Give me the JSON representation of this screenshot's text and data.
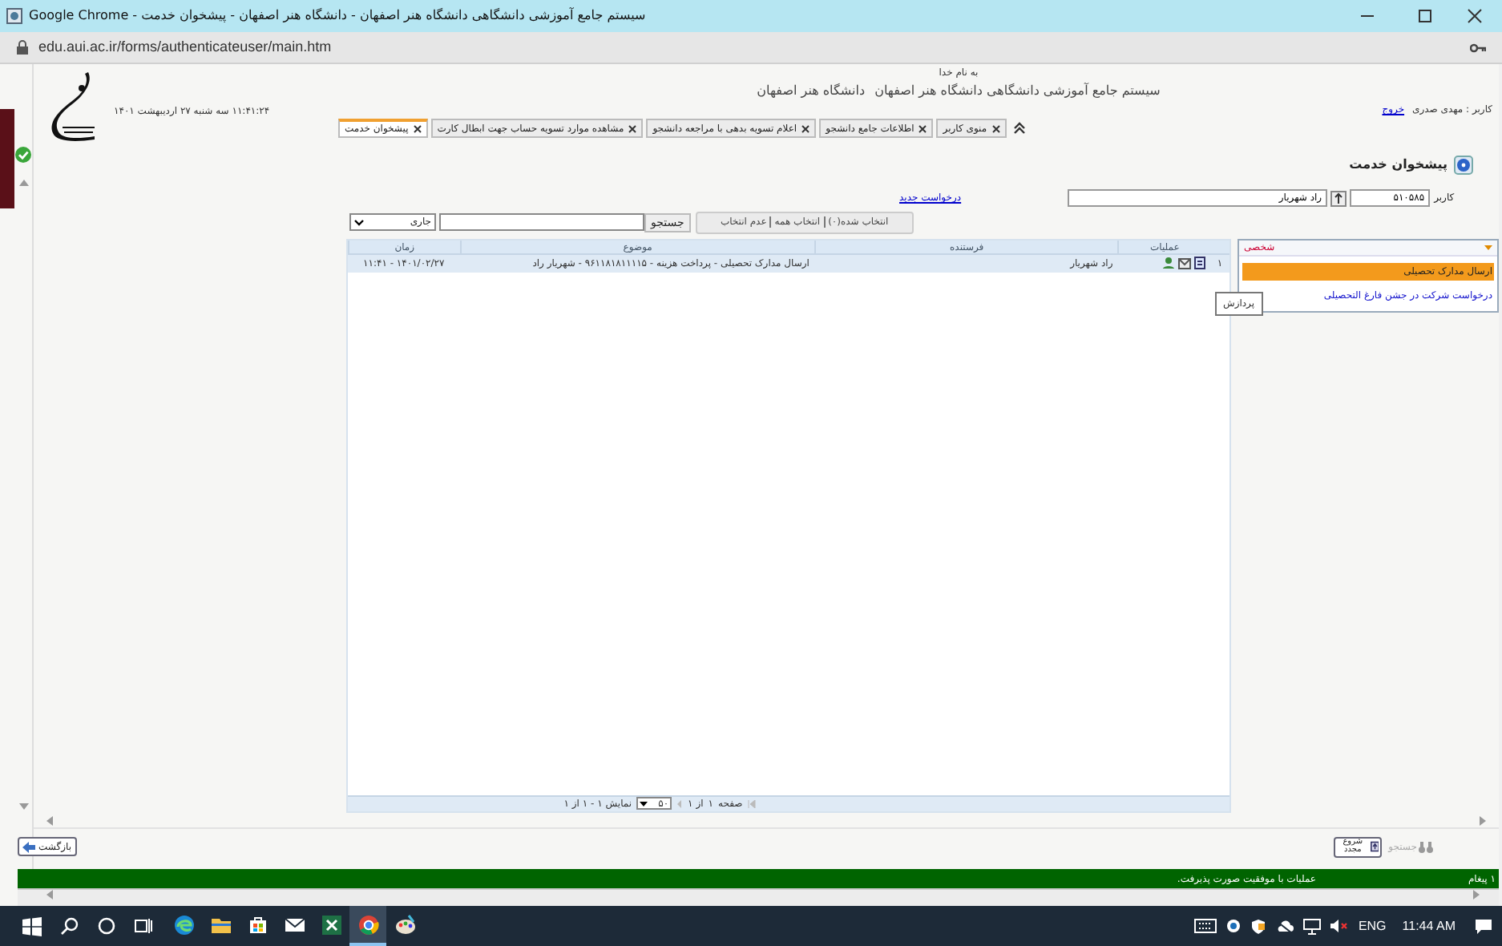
{
  "window": {
    "title": "سیستم جامع آموزشی دانشگاهی دانشگاه هنر اصفهان - دانشگاه هنر اصفهان - پیشخوان خدمت - Google Chrome",
    "url": "edu.aui.ac.ir/forms/authenticateuser/main.htm"
  },
  "header": {
    "bismillah": "به نام خدا",
    "title": "سیستم جامع آموزشی دانشگاهی دانشگاه هنر اصفهان",
    "subtitle": "دانشگاه هنر اصفهان",
    "datetime": "۱۱:۴۱:۲۴ سه شنبه ۲۷ اردیبهشت ۱۴۰۱",
    "user": "کاربر : مهدی صدری",
    "logout": "خروج"
  },
  "tabs": [
    {
      "label": "منوی کاربر",
      "selected": false
    },
    {
      "label": "اطلاعات جامع دانشجو",
      "selected": false
    },
    {
      "label": "اعلام تسویه بدهی با مراجعه دانشجو",
      "selected": false
    },
    {
      "label": "مشاهده موارد تسویه حساب جهت ابطال کارت",
      "selected": false
    },
    {
      "label": "پیشخوان خدمت",
      "selected": true
    }
  ],
  "page_title": "پیشخوان خدمت",
  "filter": {
    "label": "کاربر",
    "code": "۵۱۰۵۸۵",
    "name": "راد شهریار",
    "new_request": "درخواست جدید"
  },
  "selection": {
    "selected": "انتخاب شده(۰)",
    "select_all": "انتخاب همه",
    "deselect": "عدم انتخاب"
  },
  "search": {
    "button": "جستجو",
    "status": "جاری"
  },
  "table": {
    "columns": [
      "عملیات",
      "فرستنده",
      "موضوع",
      "زمان"
    ],
    "rows": [
      {
        "number": "۱",
        "sender": "راد شهریار",
        "subject": "ارسال مدارک تحصیلی - پرداخت هزینه - ۹۶۱۱۸۱۸۱۱۱۱۵ - شهریار راد",
        "time": "۱۴۰۱/۰۲/۲۷ - ۱۱:۴۱",
        "selected": true
      }
    ]
  },
  "pager": {
    "page_label": "صفحه",
    "page": "۱",
    "of": "از ۱",
    "page_size": "۵۰",
    "summary": "نمایش ۱ - ۱ از ۱"
  },
  "side_panel": {
    "title": "شخصی",
    "items": [
      {
        "label": "ارسال مدارک تحصیلی",
        "selected": true
      },
      {
        "label": "درخواست شرکت در جشن فارغ التحصیلی",
        "selected": false
      }
    ]
  },
  "tooltip": "پردازش",
  "buttons": {
    "back": "بازگشت",
    "restart": "شروع مجدد",
    "search": "جستجو",
    "search_disabled": true
  },
  "status": {
    "count": "۱ پیغام",
    "message": "عملیات با موفقیت صورت پذیرفت."
  },
  "taskbar": {
    "apps": [
      {
        "kind": "edge",
        "active": false
      },
      {
        "kind": "explorer",
        "active": false
      },
      {
        "kind": "store",
        "active": false
      },
      {
        "kind": "mail",
        "active": false
      },
      {
        "kind": "excel",
        "active": false
      },
      {
        "kind": "chrome",
        "active": true
      },
      {
        "kind": "paint",
        "active": false
      }
    ],
    "language": "ENG",
    "time": "11:44 AM"
  }
}
